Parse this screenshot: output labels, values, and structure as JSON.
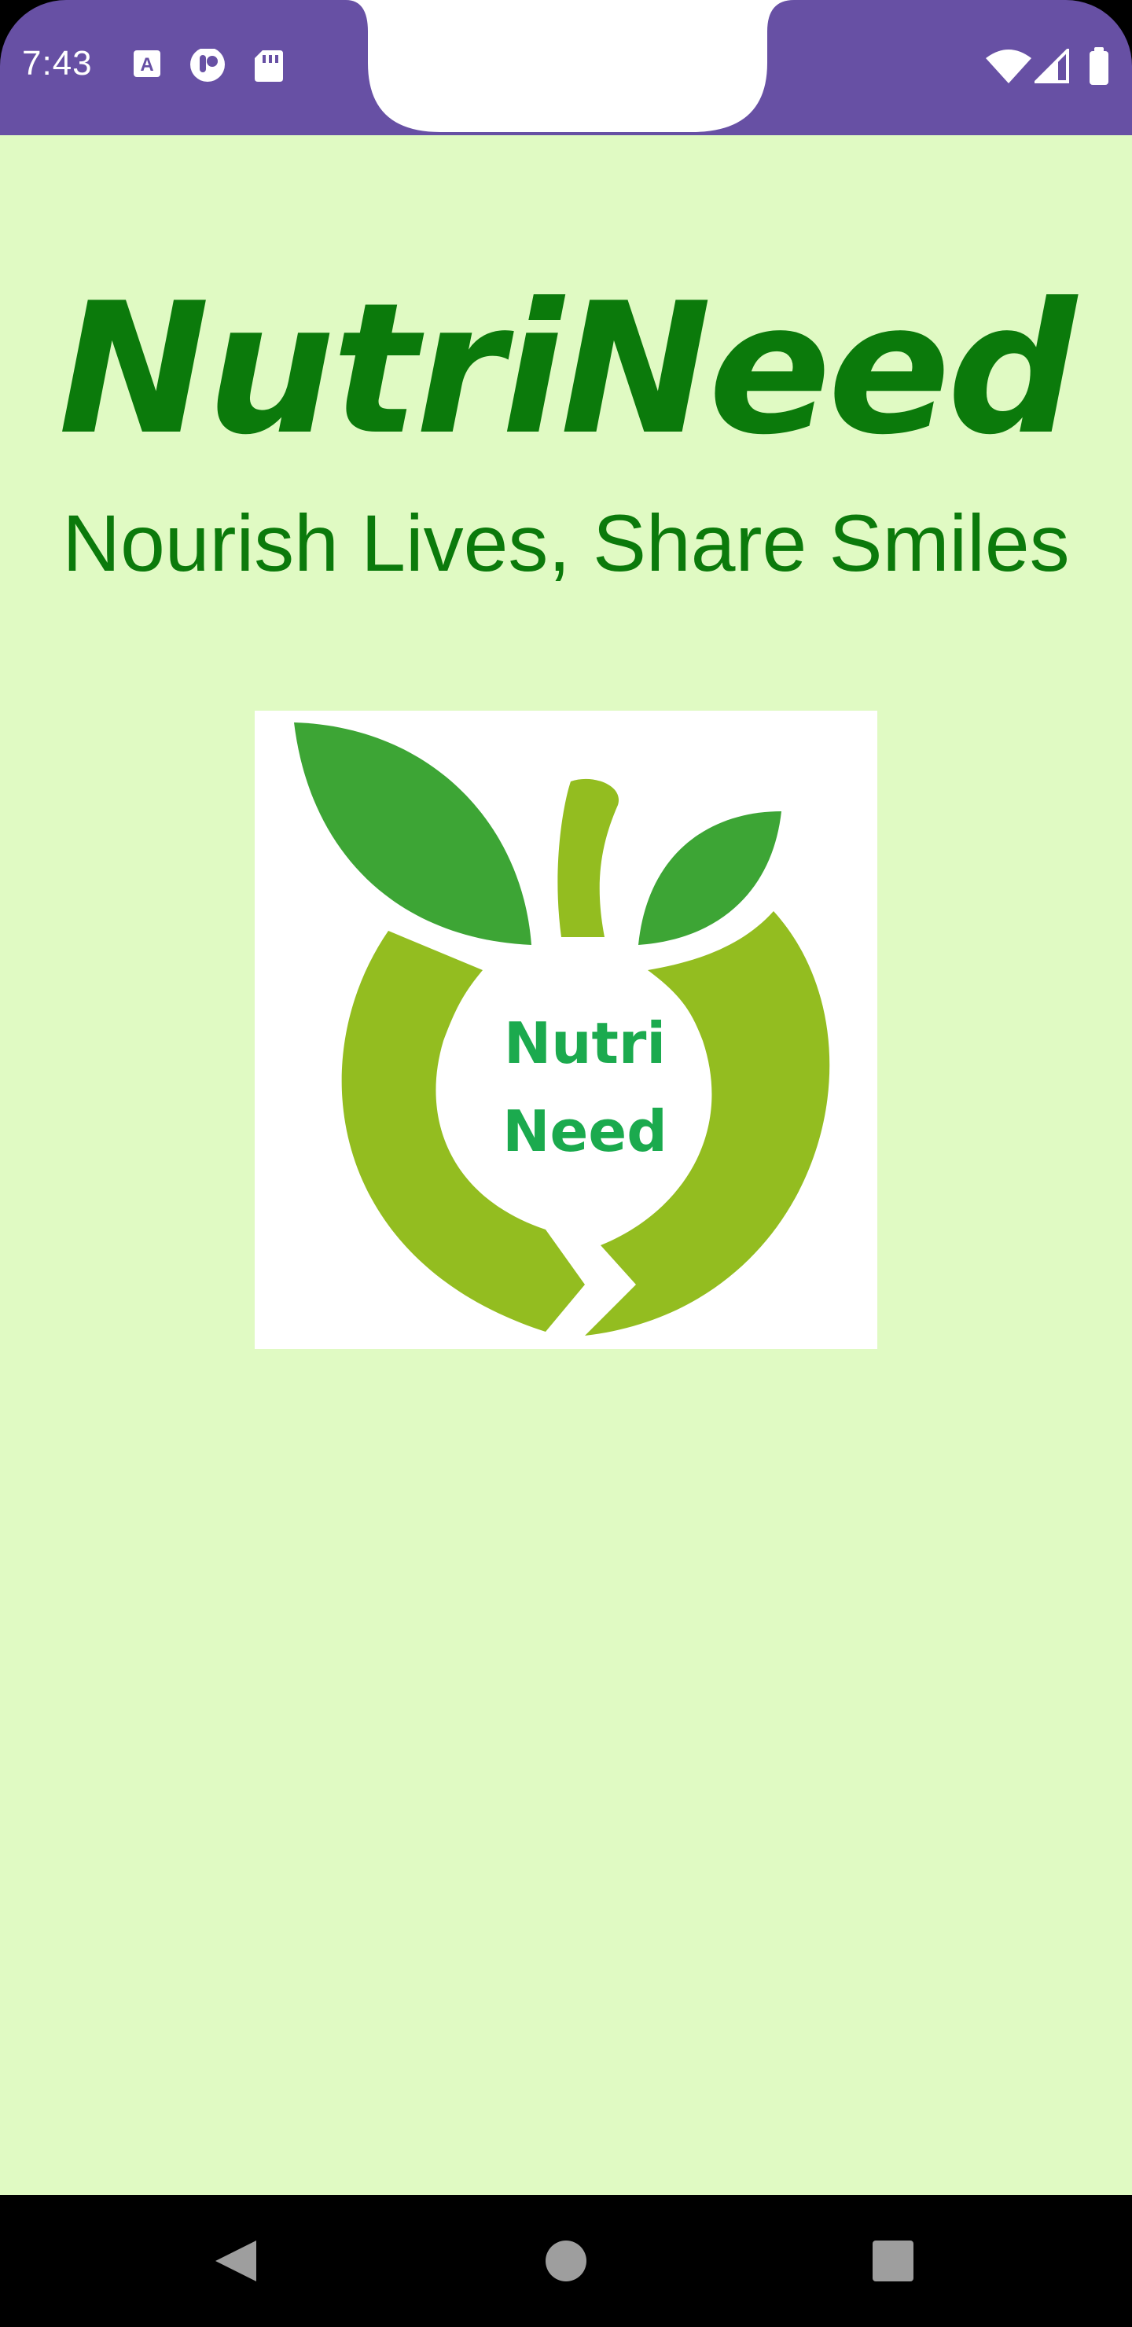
{
  "status_bar": {
    "time": "7:43",
    "left_icons": [
      "text-a-icon",
      "assistant-icon",
      "sd-card-icon"
    ],
    "right_icons": [
      "wifi-icon",
      "signal-icon",
      "battery-icon"
    ],
    "color": "#6750A4"
  },
  "app": {
    "title": "NutriNeed",
    "tagline": "Nourish Lives, Share Smiles",
    "background_color": "#E0FAC3",
    "text_color": "#0B7A0B",
    "logo": {
      "text_line1": "Nutri",
      "text_line2": "Need",
      "leaf_color": "#3DA535",
      "apple_color": "#93BD20",
      "text_color": "#1BAA4E"
    }
  },
  "nav_bar": {
    "buttons": [
      "back-icon",
      "home-icon",
      "recents-icon"
    ]
  }
}
